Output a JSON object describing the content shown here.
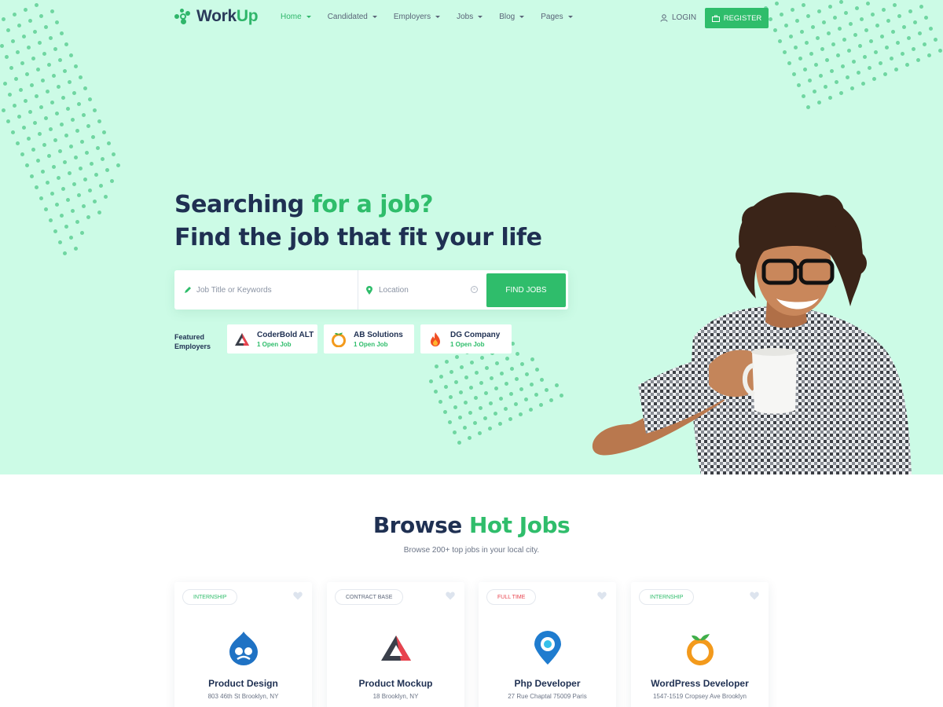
{
  "brand": {
    "name_part1": "Work",
    "name_part2": "Up",
    "accent": "#2fbd6b",
    "navy": "#1f3052",
    "hero_bg": "#ccfbe6"
  },
  "nav": {
    "items": [
      {
        "label": "Home",
        "active": true
      },
      {
        "label": "Candidated"
      },
      {
        "label": "Employers"
      },
      {
        "label": "Jobs"
      },
      {
        "label": "Blog"
      },
      {
        "label": "Pages"
      }
    ],
    "login": "LOGIN",
    "register": "REGISTER"
  },
  "hero": {
    "line1_a": "Searching",
    "line1_b": "for a job?",
    "line2": "Find the job that fit your life",
    "search": {
      "keyword_placeholder": "Job Title or Keywords",
      "location_placeholder": "Location",
      "button": "FIND JOBS"
    },
    "featured_label_1": "Featured",
    "featured_label_2": "Employers",
    "employers": [
      {
        "name": "CoderBold ALT",
        "open": "1 Open Job",
        "icon": "triangle-logo-icon"
      },
      {
        "name": "AB Solutions",
        "open": "1 Open Job",
        "icon": "orange-logo-icon"
      },
      {
        "name": "DG Company",
        "open": "1 Open Job",
        "icon": "flame-logo-icon"
      }
    ]
  },
  "hot_jobs": {
    "title_a": "Browse",
    "title_b": "Hot Jobs",
    "subtitle": "Browse 200+ top jobs in your local city.",
    "cards": [
      {
        "tag": "INTERNSHIP",
        "tag_color": "#2fbd6b",
        "title": "Product Design",
        "address": "803 46th St Brooklyn, NY",
        "icon": "drupal-logo-icon"
      },
      {
        "tag": "CONTRACT BASE",
        "tag_color": "#5a6478",
        "title": "Product Mockup",
        "address": "18 Brooklyn, NY",
        "icon": "triangle-logo-icon"
      },
      {
        "tag": "FULL TIME",
        "tag_color": "#e8434e",
        "title": "Php Developer",
        "address": "27 Rue Chaptal 75009 Paris",
        "icon": "map-pin-logo-icon"
      },
      {
        "tag": "INTERNSHIP",
        "tag_color": "#2fbd6b",
        "title": "WordPress Developer",
        "address": "1547-1519 Cropsey Ave Brooklyn",
        "icon": "orange-logo-icon"
      }
    ]
  }
}
